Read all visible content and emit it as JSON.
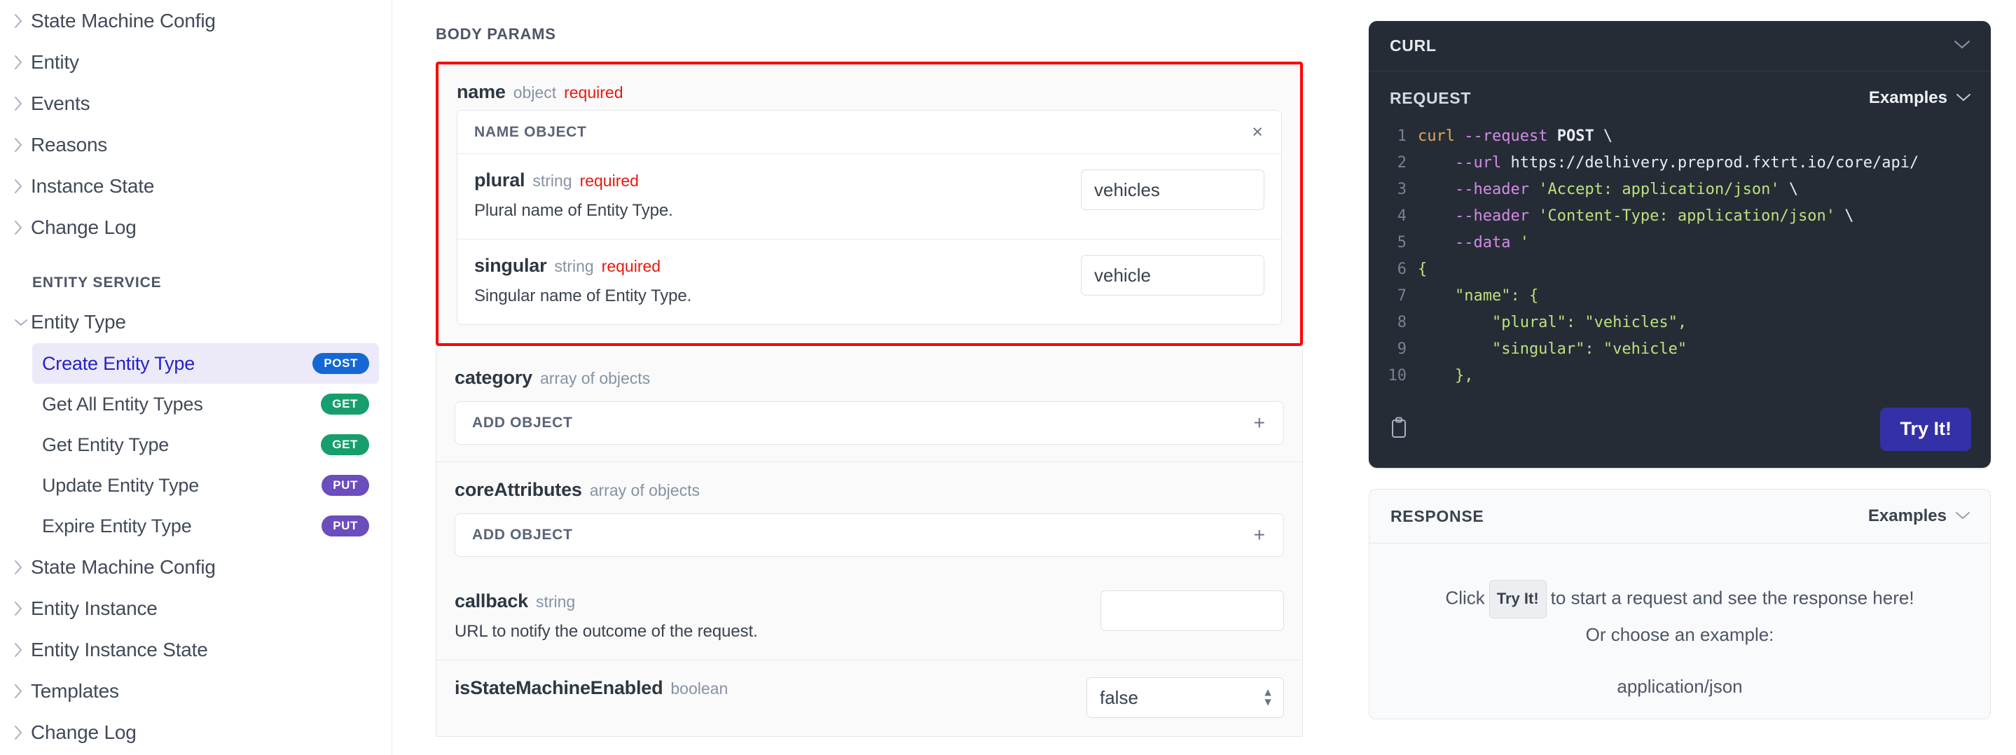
{
  "sidebar": {
    "top_nav": [
      {
        "label": "State Machine Config",
        "icon": "chevron-right-icon",
        "expanded": false
      },
      {
        "label": "Entity",
        "icon": "chevron-right-icon",
        "expanded": false
      },
      {
        "label": "Events",
        "icon": "chevron-right-icon",
        "expanded": false
      },
      {
        "label": "Reasons",
        "icon": "chevron-right-icon",
        "expanded": false
      },
      {
        "label": "Instance State",
        "icon": "chevron-right-icon",
        "expanded": false
      },
      {
        "label": "Change Log",
        "icon": "chevron-right-icon",
        "expanded": false
      }
    ],
    "section_title": "ENTITY SERVICE",
    "group_label": "Entity Type",
    "group_icon": "chevron-down-icon",
    "endpoints": [
      {
        "label": "Create Entity Type",
        "method": "POST",
        "active": true
      },
      {
        "label": "Get All Entity Types",
        "method": "GET",
        "active": false
      },
      {
        "label": "Get Entity Type",
        "method": "GET",
        "active": false
      },
      {
        "label": "Update Entity Type",
        "method": "PUT",
        "active": false
      },
      {
        "label": "Expire Entity Type",
        "method": "PUT",
        "active": false
      }
    ],
    "bottom_nav": [
      {
        "label": "State Machine Config",
        "icon": "chevron-right-icon"
      },
      {
        "label": "Entity Instance",
        "icon": "chevron-right-icon"
      },
      {
        "label": "Entity Instance State",
        "icon": "chevron-right-icon"
      },
      {
        "label": "Templates",
        "icon": "chevron-right-icon"
      },
      {
        "label": "Change Log",
        "icon": "chevron-right-icon"
      }
    ],
    "colors": {
      "post": "#1568d4",
      "get": "#179e6d",
      "put": "#6b4dbd",
      "active_bg": "#eceaf8",
      "active_text": "#2621c7"
    }
  },
  "main": {
    "title": "BODY PARAMS",
    "highlight_color": "#ff0000",
    "name_param": {
      "name": "name",
      "type": "object",
      "required": "required",
      "object_header": "NAME OBJECT",
      "close_icon_label": "×",
      "fields": [
        {
          "name": "plural",
          "type": "string",
          "required": "required",
          "description": "Plural name of Entity Type.",
          "value": "vehicles"
        },
        {
          "name": "singular",
          "type": "string",
          "required": "required",
          "description": "Singular name of Entity Type.",
          "value": "vehicle"
        }
      ]
    },
    "params": [
      {
        "name": "category",
        "type": "array of objects",
        "add_label": "ADD OBJECT",
        "add_icon": "plus-icon"
      },
      {
        "name": "coreAttributes",
        "type": "array of objects",
        "add_label": "ADD OBJECT",
        "add_icon": "plus-icon"
      }
    ],
    "callback": {
      "name": "callback",
      "type": "string",
      "description": "URL to notify the outcome of the request.",
      "value": ""
    },
    "state_machine": {
      "name": "isStateMachineEnabled",
      "type": "boolean",
      "value": "false"
    }
  },
  "right": {
    "code_panel": {
      "language": "CURL",
      "collapse_icon": "chevron-down-icon",
      "request_label": "REQUEST",
      "examples_label": "Examples",
      "examples_icon": "chevron-down-icon",
      "copy_icon": "clipboard-icon",
      "try_button": "Try It!",
      "lines": [
        {
          "n": "1",
          "tokens": [
            {
              "t": "cmd",
              "v": "curl"
            },
            {
              "t": "plain",
              "v": " "
            },
            {
              "t": "flag",
              "v": "--request"
            },
            {
              "t": "plain",
              "v": " "
            },
            {
              "t": "kw",
              "v": "POST"
            },
            {
              "t": "plain",
              "v": " \\"
            }
          ]
        },
        {
          "n": "2",
          "tokens": [
            {
              "t": "plain",
              "v": "    "
            },
            {
              "t": "flag",
              "v": "--url"
            },
            {
              "t": "plain",
              "v": " https://delhivery.preprod.fxtrt.io/core/api/"
            }
          ]
        },
        {
          "n": "3",
          "tokens": [
            {
              "t": "plain",
              "v": "    "
            },
            {
              "t": "flag",
              "v": "--header"
            },
            {
              "t": "plain",
              "v": " "
            },
            {
              "t": "str",
              "v": "'Accept: application/json'"
            },
            {
              "t": "plain",
              "v": " \\"
            }
          ]
        },
        {
          "n": "4",
          "tokens": [
            {
              "t": "plain",
              "v": "    "
            },
            {
              "t": "flag",
              "v": "--header"
            },
            {
              "t": "plain",
              "v": " "
            },
            {
              "t": "str",
              "v": "'Content-Type: application/json'"
            },
            {
              "t": "plain",
              "v": " \\"
            }
          ]
        },
        {
          "n": "5",
          "tokens": [
            {
              "t": "plain",
              "v": "    "
            },
            {
              "t": "flag",
              "v": "--data"
            },
            {
              "t": "plain",
              "v": " "
            },
            {
              "t": "str",
              "v": "'"
            }
          ]
        },
        {
          "n": "6",
          "tokens": [
            {
              "t": "str",
              "v": "{"
            }
          ]
        },
        {
          "n": "7",
          "tokens": [
            {
              "t": "str",
              "v": "    \"name\": {"
            }
          ]
        },
        {
          "n": "8",
          "tokens": [
            {
              "t": "str",
              "v": "        \"plural\": \"vehicles\","
            }
          ]
        },
        {
          "n": "9",
          "tokens": [
            {
              "t": "str",
              "v": "        \"singular\": \"vehicle\""
            }
          ]
        },
        {
          "n": "10",
          "tokens": [
            {
              "t": "str",
              "v": "    },"
            }
          ]
        }
      ]
    },
    "response_panel": {
      "title": "RESPONSE",
      "examples_label": "Examples",
      "examples_icon": "chevron-down-icon",
      "message_before": "Click",
      "inline_button": "Try It!",
      "message_after": "to start a request and see the response here!",
      "message_line2": "Or choose an example:",
      "example_option": "application/json"
    }
  }
}
